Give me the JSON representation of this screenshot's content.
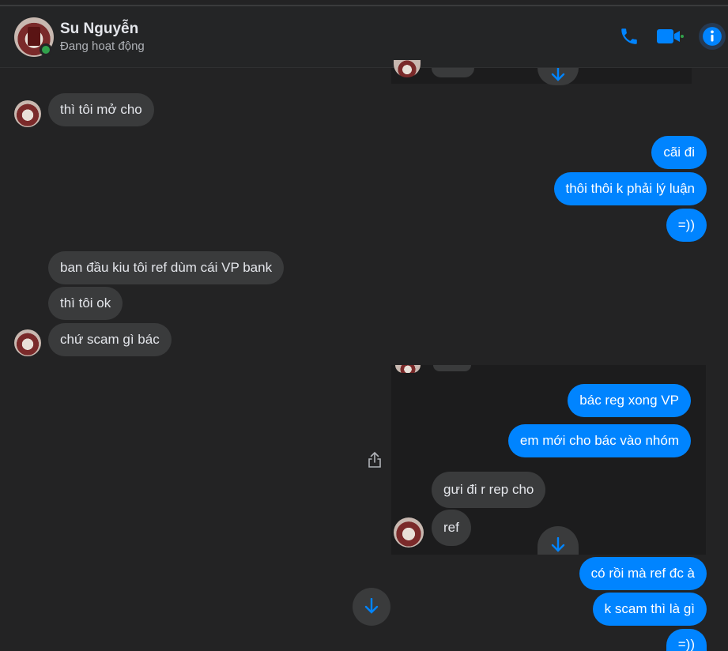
{
  "contact": {
    "name": "Su Nguyễn",
    "status": "Đang hoạt động"
  },
  "icons": {
    "phone": "phone-icon",
    "video": "video-camera-icon",
    "info": "info-icon",
    "scroll_down": "arrow-down-icon",
    "share": "share-icon"
  },
  "colors": {
    "accent": "#0084ff",
    "online": "#31a24c",
    "incoming_bubble": "#3a3b3c",
    "background": "#232324"
  },
  "messages": {
    "m1": "thì tôi mở cho",
    "m2": "cãi đi",
    "m3": "thôi thôi k phải lý luận",
    "m4": "=))",
    "m5": "ban đầu kiu tôi ref dùm cái VP bank",
    "m6": "thì tôi ok",
    "m7": "chứ scam gì bác",
    "m8": "bác reg xong VP",
    "m9": "em mới cho bác vào nhóm",
    "m10": "gưi đi r rep cho",
    "m11": "ref",
    "m12": "có rồi mà ref đc à",
    "m13": "k scam thì là gì",
    "m14": "=))"
  }
}
